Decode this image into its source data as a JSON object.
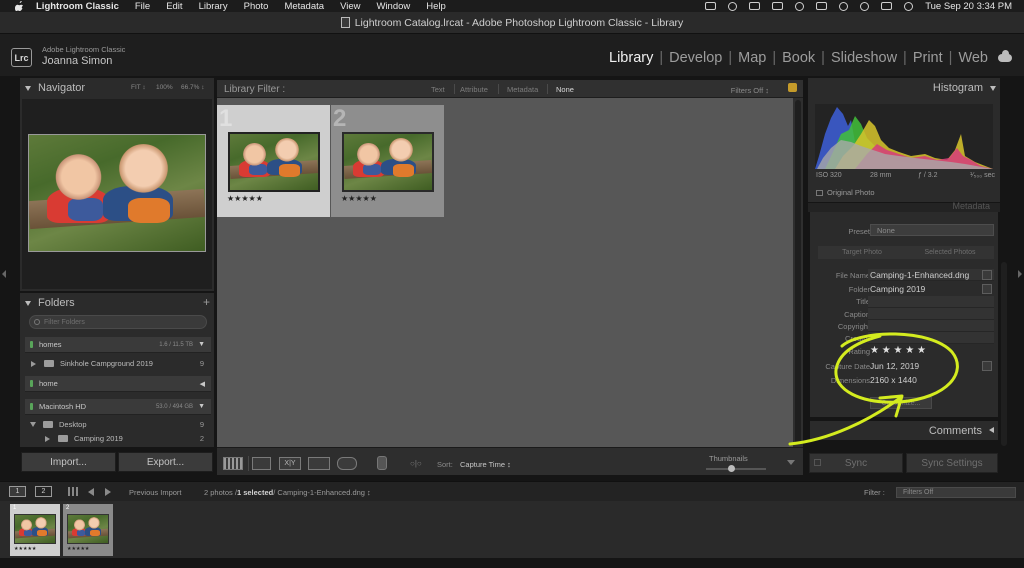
{
  "menubar": {
    "app_name": "Lightroom Classic",
    "items": [
      "File",
      "Edit",
      "Library",
      "Photo",
      "Metadata",
      "View",
      "Window",
      "Help"
    ],
    "clock": "Tue Sep 20  3:34 PM"
  },
  "window": {
    "title": "Lightroom Catalog.lrcat - Adobe Photoshop Lightroom Classic - Library"
  },
  "identity": {
    "badge": "Lrc",
    "brand": "Adobe Lightroom Classic",
    "user": "Joanna Simon"
  },
  "modules": [
    "Library",
    "Develop",
    "Map",
    "Book",
    "Slideshow",
    "Print",
    "Web"
  ],
  "navigator": {
    "title": "Navigator",
    "zoom_fit": "FIT ↕",
    "zoom_100": "100%",
    "zoom_pct": "66.7% ↕"
  },
  "folders": {
    "title": "Folders",
    "add": "+",
    "search_placeholder": "Filter Folders",
    "volumes": [
      {
        "name": "homes",
        "size": "1.6 / 11.5 TB",
        "arrow": "▼"
      },
      {
        "name": "home",
        "size": "",
        "arrow": "◀"
      },
      {
        "name": "Macintosh HD",
        "size": "53.0 / 494 GB",
        "arrow": "▼"
      }
    ],
    "rows": [
      {
        "name": "Sinkhole Campground 2019",
        "count": "9"
      },
      {
        "name": "Desktop",
        "count": "9"
      },
      {
        "name": "Camping 2019",
        "count": "2"
      }
    ]
  },
  "left_buttons": {
    "import": "Import...",
    "export": "Export..."
  },
  "filter_bar": {
    "label": "Library Filter :",
    "options": [
      "Text",
      "Attribute",
      "Metadata",
      "None"
    ],
    "status": "Filters Off ↕"
  },
  "grid": {
    "cells": [
      {
        "index": "1",
        "stars": "★★★★★"
      },
      {
        "index": "2",
        "stars": "★★★★★"
      }
    ]
  },
  "toolbar": {
    "compare": "X|Y",
    "spray_label": "○|○",
    "sort_label": "Sort:",
    "sort_value": "Capture Time ↕",
    "thumbnails_label": "Thumbnails"
  },
  "histogram": {
    "title": "Histogram",
    "iso": "ISO 320",
    "focal": "28 mm",
    "aperture": "ƒ / 3.2",
    "shutter": "¹⁄₅₀₀ sec",
    "original_photo": "Original Photo"
  },
  "metadata": {
    "header": "Metadata",
    "preset_label": "Preset",
    "preset_value": "None",
    "tab_target": "Target Photo",
    "tab_selected": "Selected Photos",
    "fields": [
      {
        "label": "File Name",
        "value": "Camping-1-Enhanced.dng"
      },
      {
        "label": "Folder",
        "value": "Camping 2019"
      },
      {
        "label": "Title",
        "value": ""
      },
      {
        "label": "Caption",
        "value": ""
      },
      {
        "label": "Copyright",
        "value": ""
      },
      {
        "label": "Creator",
        "value": ""
      },
      {
        "label": "Rating",
        "value": "★ ★ ★ ★ ★"
      },
      {
        "label": "Capture Date",
        "value": "Jun 12, 2019"
      },
      {
        "label": "Dimensions",
        "value": "2160 x 1440"
      }
    ],
    "customize": "Customize..."
  },
  "comments": {
    "title": "Comments"
  },
  "right_buttons": {
    "sync": "Sync",
    "sync_settings": "Sync Settings"
  },
  "filmstrip_bar": {
    "view1": "1",
    "view2": "2",
    "source": "Previous Import",
    "count_prefix": "2 photos /",
    "count_selected": "1 selected",
    "count_file": "/ Camping-1-Enhanced.dng ↕",
    "filter_label": "Filter :",
    "filter_value": "Filters Off"
  },
  "filmstrip": {
    "cells": [
      {
        "index": "1",
        "stars": "★★★★★"
      },
      {
        "index": "2",
        "stars": "★★★★★"
      }
    ]
  },
  "colors": {
    "annotation": "#d4ec1f",
    "accent_green": "#59a55a",
    "lock": "#c59b2a"
  }
}
